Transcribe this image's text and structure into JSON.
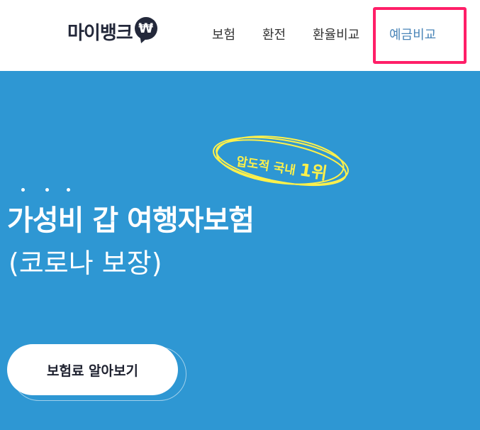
{
  "header": {
    "logo_text": "마이뱅크",
    "logo_symbol": "₩",
    "nav": [
      {
        "label": "보험"
      },
      {
        "label": "환전"
      },
      {
        "label": "환율비교"
      },
      {
        "label": "예금비교"
      }
    ]
  },
  "hero": {
    "badge_text": "압도적 국내",
    "badge_rank": "1위",
    "headline": "가성비 갑 여행자보험",
    "subheadline": "(코로나 보장)",
    "cta_label": "보험료 알아보기"
  },
  "colors": {
    "hero_bg": "#2e97d3",
    "badge_yellow": "#fff14a",
    "highlight_pink": "#ff1f68",
    "active_nav": "#4a85b8"
  }
}
